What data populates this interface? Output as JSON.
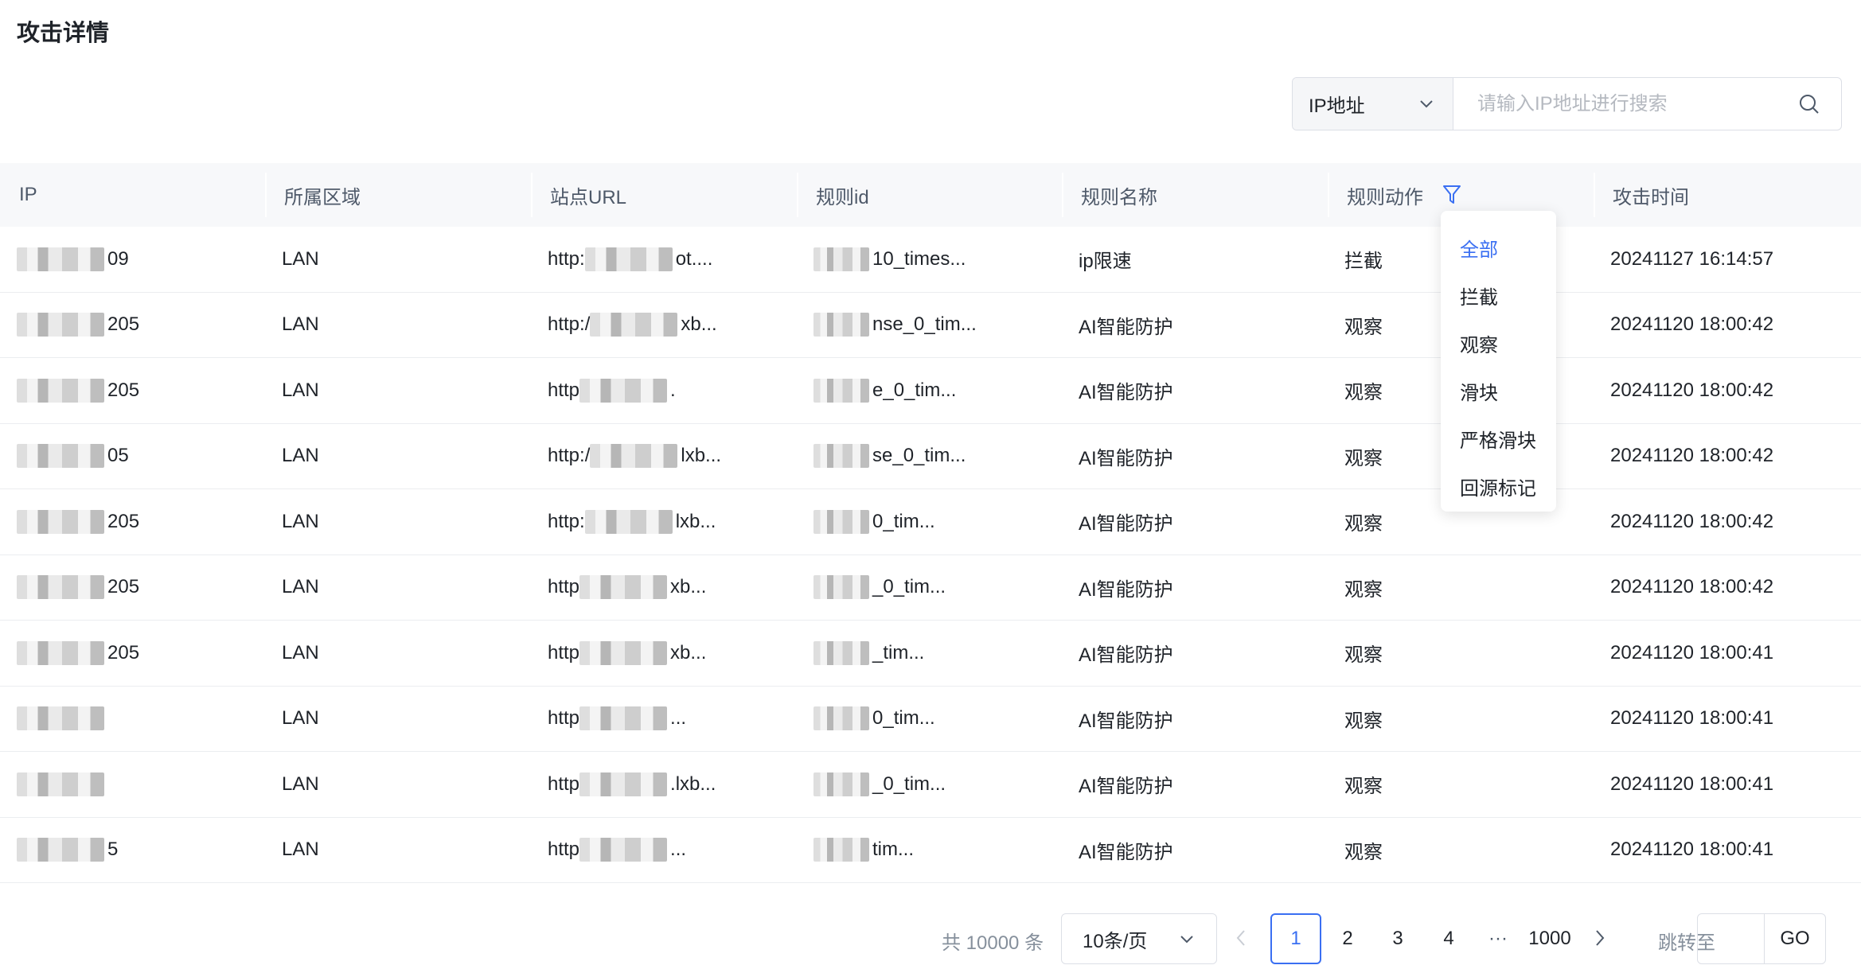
{
  "page": {
    "title": "攻击详情"
  },
  "search": {
    "type_label": "IP地址",
    "placeholder": "请输入IP地址进行搜索"
  },
  "table": {
    "columns": [
      "IP",
      "所属区域",
      "站点URL",
      "规则id",
      "规则名称",
      "规则动作",
      "攻击时间"
    ],
    "rows": [
      {
        "ip": "09",
        "region": "LAN",
        "url_prefix": "http:",
        "url_suffix": "ot....",
        "rule_id": "10_times...",
        "rule_name": "ip限速",
        "action": "拦截",
        "time": "20241127 16:14:57"
      },
      {
        "ip": "205",
        "region": "LAN",
        "url_prefix": "http:/",
        "url_suffix": "xb...",
        "rule_id": "nse_0_tim...",
        "rule_name": "AI智能防护",
        "action": "观察",
        "time": "20241120 18:00:42"
      },
      {
        "ip": "205",
        "region": "LAN",
        "url_prefix": "http",
        "url_suffix": ".",
        "rule_id": "e_0_tim...",
        "rule_name": "AI智能防护",
        "action": "观察",
        "time": "20241120 18:00:42"
      },
      {
        "ip": "05",
        "region": "LAN",
        "url_prefix": "http:/",
        "url_suffix": "lxb...",
        "rule_id": "se_0_tim...",
        "rule_name": "AI智能防护",
        "action": "观察",
        "time": "20241120 18:00:42"
      },
      {
        "ip": "205",
        "region": "LAN",
        "url_prefix": "http:",
        "url_suffix": "lxb...",
        "rule_id": "0_tim...",
        "rule_name": "AI智能防护",
        "action": "观察",
        "time": "20241120 18:00:42"
      },
      {
        "ip": "205",
        "region": "LAN",
        "url_prefix": "http",
        "url_suffix": "xb...",
        "rule_id": "_0_tim...",
        "rule_name": "AI智能防护",
        "action": "观察",
        "time": "20241120 18:00:42"
      },
      {
        "ip": "205",
        "region": "LAN",
        "url_prefix": "http",
        "url_suffix": "xb...",
        "rule_id": "_tim...",
        "rule_name": "AI智能防护",
        "action": "观察",
        "time": "20241120 18:00:41"
      },
      {
        "ip": "",
        "region": "LAN",
        "url_prefix": "http",
        "url_suffix": "...",
        "rule_id": "0_tim...",
        "rule_name": "AI智能防护",
        "action": "观察",
        "time": "20241120 18:00:41"
      },
      {
        "ip": "",
        "region": "LAN",
        "url_prefix": "http",
        "url_suffix": ".lxb...",
        "rule_id": "_0_tim...",
        "rule_name": "AI智能防护",
        "action": "观察",
        "time": "20241120 18:00:41"
      },
      {
        "ip": "5",
        "region": "LAN",
        "url_prefix": "http",
        "url_suffix": "...",
        "rule_id": "tim...",
        "rule_name": "AI智能防护",
        "action": "观察",
        "time": "20241120 18:00:41"
      }
    ]
  },
  "filter_dropdown": {
    "items": [
      "全部",
      "拦截",
      "观察",
      "滑块",
      "严格滑块",
      "回源标记"
    ],
    "active": "全部"
  },
  "pagination": {
    "total": "共 10000 条",
    "page_size": "10条/页",
    "pages": [
      "1",
      "2",
      "3",
      "4",
      "1000"
    ],
    "ellipsis": "···",
    "current": "1",
    "jump_label": "跳转至",
    "go_label": "GO"
  },
  "colors": {
    "accent": "#3a6ff2",
    "header_bg": "#f7f8fa",
    "border": "#dcdfe6"
  }
}
